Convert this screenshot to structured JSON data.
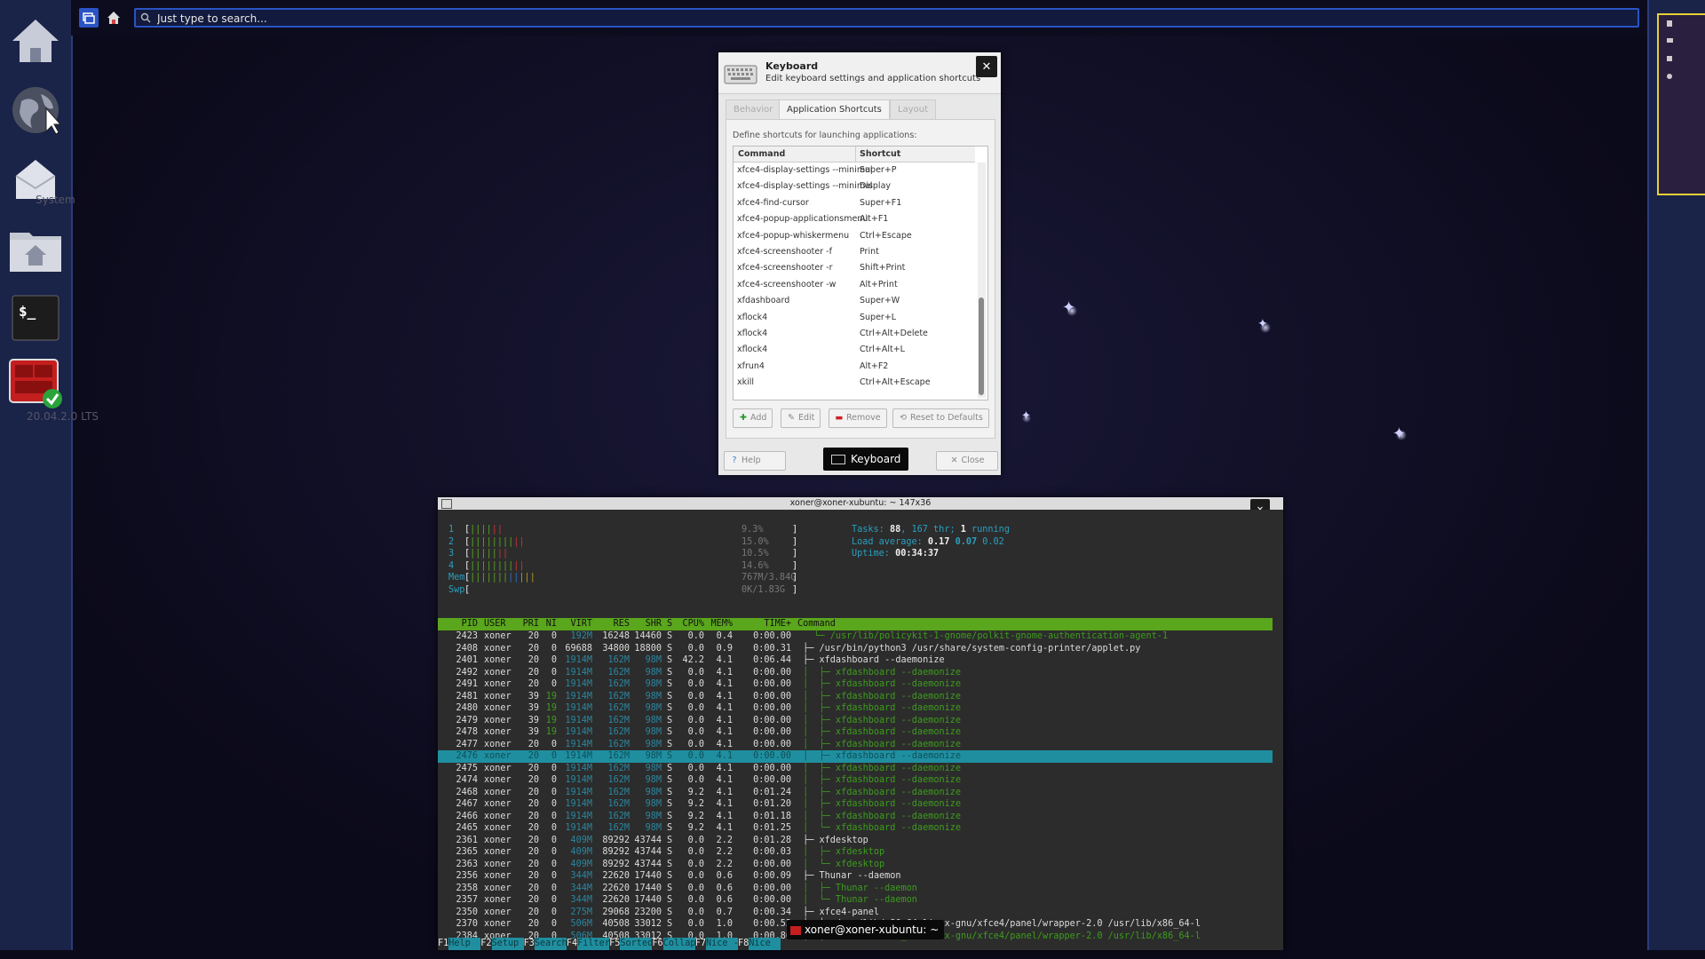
{
  "top_bar": {
    "search_placeholder": "Just type to search..."
  },
  "desktop": {
    "labels": [
      "System",
      "20.04.2.0 LTS"
    ]
  },
  "keyboard_dialog": {
    "title": "Keyboard",
    "subtitle": "Edit keyboard settings and application shortcuts",
    "tabs": [
      "Behavior",
      "Application Shortcuts",
      "Layout"
    ],
    "active_tab": "Application Shortcuts",
    "description": "Define shortcuts for launching applications:",
    "columns": [
      "Command",
      "Shortcut"
    ],
    "rows": [
      [
        "xfce4-display-settings --minimal",
        "Super+P"
      ],
      [
        "xfce4-display-settings --minimal",
        "Display"
      ],
      [
        "xfce4-find-cursor",
        "Super+F1"
      ],
      [
        "xfce4-popup-applicationsmenu",
        "Alt+F1"
      ],
      [
        "xfce4-popup-whiskermenu",
        "Ctrl+Escape"
      ],
      [
        "xfce4-screenshooter -f",
        "Print"
      ],
      [
        "xfce4-screenshooter -r",
        "Shift+Print"
      ],
      [
        "xfce4-screenshooter -w",
        "Alt+Print"
      ],
      [
        "xfdashboard",
        "Super+W"
      ],
      [
        "xflock4",
        "Super+L"
      ],
      [
        "xflock4",
        "Ctrl+Alt+Delete"
      ],
      [
        "xflock4",
        "Ctrl+Alt+L"
      ],
      [
        "xfrun4",
        "Alt+F2"
      ],
      [
        "xkill",
        "Ctrl+Alt+Escape"
      ]
    ],
    "buttons": {
      "add": "Add",
      "edit": "Edit",
      "remove": "Remove",
      "reset": "Reset to Defaults",
      "help": "Help",
      "close": "Close"
    },
    "tooltip": "Keyboard"
  },
  "terminal": {
    "title": "xoner@xoner-xubuntu: ~ 147x36",
    "tooltip": "xoner@xoner-xubuntu: ~",
    "meters": [
      {
        "label": "1",
        "value": "9.3%",
        "level": 0.09
      },
      {
        "label": "2",
        "value": "15.0%",
        "level": 0.15
      },
      {
        "label": "3",
        "value": "10.5%",
        "level": 0.1
      },
      {
        "label": "4",
        "value": "14.6%",
        "level": 0.15
      },
      {
        "label": "Mem",
        "value": "767M/3.84G",
        "level": 0.2
      },
      {
        "label": "Swp",
        "value": "0K/1.83G",
        "level": 0.0
      }
    ],
    "summary": {
      "tasks_label": "Tasks:",
      "tasks": "88",
      "thr_label": "167 thr;",
      "running": "1",
      "running_label": "running",
      "load_label": "Load average:",
      "load1": "0.17",
      "load5": "0.07",
      "load15": "0.02",
      "uptime_label": "Uptime:",
      "uptime": "00:34:37"
    },
    "columns": [
      "PID",
      "USER",
      "PRI",
      "NI",
      "VIRT",
      "RES",
      "SHR",
      "S",
      "CPU%",
      "MEM%",
      "TIME+",
      "Command"
    ],
    "processes": [
      {
        "pid": "2423",
        "user": "xoner",
        "pri": "20",
        "ni": "0",
        "virt": "192M",
        "res": "16248",
        "shr": "14460",
        "s": "S",
        "cpu": "0.0",
        "mem": "0.4",
        "time": "0:00.00",
        "cmd": "   └─ /usr/lib/policykit-1-gnome/polkit-gnome-authentication-agent-1",
        "child": true
      },
      {
        "pid": "2408",
        "user": "xoner",
        "pri": "20",
        "ni": "0",
        "virt": "69688",
        "res": "34800",
        "shr": "18800",
        "s": "S",
        "cpu": "0.0",
        "mem": "0.9",
        "time": "0:00.31",
        "cmd": " ├─ /usr/bin/python3 /usr/share/system-config-printer/applet.py",
        "child": false
      },
      {
        "pid": "2401",
        "user": "xoner",
        "pri": "20",
        "ni": "0",
        "virt": "1914M",
        "res": "162M",
        "shr": "98M",
        "s": "S",
        "cpu": "42.2",
        "mem": "4.1",
        "time": "0:06.44",
        "cmd": " ├─ xfdashboard --daemonize",
        "child": false
      },
      {
        "pid": "2492",
        "user": "xoner",
        "pri": "20",
        "ni": "0",
        "virt": "1914M",
        "res": "162M",
        "shr": "98M",
        "s": "S",
        "cpu": "0.0",
        "mem": "4.1",
        "time": "0:00.00",
        "cmd": " │  ├─ xfdashboard --daemonize",
        "child": true
      },
      {
        "pid": "2491",
        "user": "xoner",
        "pri": "20",
        "ni": "0",
        "virt": "1914M",
        "res": "162M",
        "shr": "98M",
        "s": "S",
        "cpu": "0.0",
        "mem": "4.1",
        "time": "0:00.00",
        "cmd": " │  ├─ xfdashboard --daemonize",
        "child": true
      },
      {
        "pid": "2481",
        "user": "xoner",
        "pri": "39",
        "ni": "19",
        "virt": "1914M",
        "res": "162M",
        "shr": "98M",
        "s": "S",
        "cpu": "0.0",
        "mem": "4.1",
        "time": "0:00.00",
        "cmd": " │  ├─ xfdashboard --daemonize",
        "child": true
      },
      {
        "pid": "2480",
        "user": "xoner",
        "pri": "39",
        "ni": "19",
        "virt": "1914M",
        "res": "162M",
        "shr": "98M",
        "s": "S",
        "cpu": "0.0",
        "mem": "4.1",
        "time": "0:00.00",
        "cmd": " │  ├─ xfdashboard --daemonize",
        "child": true
      },
      {
        "pid": "2479",
        "user": "xoner",
        "pri": "39",
        "ni": "19",
        "virt": "1914M",
        "res": "162M",
        "shr": "98M",
        "s": "S",
        "cpu": "0.0",
        "mem": "4.1",
        "time": "0:00.00",
        "cmd": " │  ├─ xfdashboard --daemonize",
        "child": true
      },
      {
        "pid": "2478",
        "user": "xoner",
        "pri": "39",
        "ni": "19",
        "virt": "1914M",
        "res": "162M",
        "shr": "98M",
        "s": "S",
        "cpu": "0.0",
        "mem": "4.1",
        "time": "0:00.00",
        "cmd": " │  ├─ xfdashboard --daemonize",
        "child": true
      },
      {
        "pid": "2477",
        "user": "xoner",
        "pri": "20",
        "ni": "0",
        "virt": "1914M",
        "res": "162M",
        "shr": "98M",
        "s": "S",
        "cpu": "0.0",
        "mem": "4.1",
        "time": "0:00.00",
        "cmd": " │  ├─ xfdashboard --daemonize",
        "child": true
      },
      {
        "pid": "2476",
        "user": "xoner",
        "pri": "20",
        "ni": "0",
        "virt": "1914M",
        "res": "162M",
        "shr": "98M",
        "s": "S",
        "cpu": "0.0",
        "mem": "4.1",
        "time": "0:00.00",
        "cmd": " │  ├─ xfdashboard --daemonize",
        "child": true,
        "selected": true
      },
      {
        "pid": "2475",
        "user": "xoner",
        "pri": "20",
        "ni": "0",
        "virt": "1914M",
        "res": "162M",
        "shr": "98M",
        "s": "S",
        "cpu": "0.0",
        "mem": "4.1",
        "time": "0:00.00",
        "cmd": " │  ├─ xfdashboard --daemonize",
        "child": true
      },
      {
        "pid": "2474",
        "user": "xoner",
        "pri": "20",
        "ni": "0",
        "virt": "1914M",
        "res": "162M",
        "shr": "98M",
        "s": "S",
        "cpu": "0.0",
        "mem": "4.1",
        "time": "0:00.00",
        "cmd": " │  ├─ xfdashboard --daemonize",
        "child": true
      },
      {
        "pid": "2468",
        "user": "xoner",
        "pri": "20",
        "ni": "0",
        "virt": "1914M",
        "res": "162M",
        "shr": "98M",
        "s": "S",
        "cpu": "9.2",
        "mem": "4.1",
        "time": "0:01.24",
        "cmd": " │  ├─ xfdashboard --daemonize",
        "child": true
      },
      {
        "pid": "2467",
        "user": "xoner",
        "pri": "20",
        "ni": "0",
        "virt": "1914M",
        "res": "162M",
        "shr": "98M",
        "s": "S",
        "cpu": "9.2",
        "mem": "4.1",
        "time": "0:01.20",
        "cmd": " │  ├─ xfdashboard --daemonize",
        "child": true
      },
      {
        "pid": "2466",
        "user": "xoner",
        "pri": "20",
        "ni": "0",
        "virt": "1914M",
        "res": "162M",
        "shr": "98M",
        "s": "S",
        "cpu": "9.2",
        "mem": "4.1",
        "time": "0:01.18",
        "cmd": " │  ├─ xfdashboard --daemonize",
        "child": true
      },
      {
        "pid": "2465",
        "user": "xoner",
        "pri": "20",
        "ni": "0",
        "virt": "1914M",
        "res": "162M",
        "shr": "98M",
        "s": "S",
        "cpu": "9.2",
        "mem": "4.1",
        "time": "0:01.25",
        "cmd": " │  └─ xfdashboard --daemonize",
        "child": true
      },
      {
        "pid": "2361",
        "user": "xoner",
        "pri": "20",
        "ni": "0",
        "virt": "409M",
        "res": "89292",
        "shr": "43744",
        "s": "S",
        "cpu": "0.0",
        "mem": "2.2",
        "time": "0:01.28",
        "cmd": " ├─ xfdesktop",
        "child": false
      },
      {
        "pid": "2365",
        "user": "xoner",
        "pri": "20",
        "ni": "0",
        "virt": "409M",
        "res": "89292",
        "shr": "43744",
        "s": "S",
        "cpu": "0.0",
        "mem": "2.2",
        "time": "0:00.03",
        "cmd": " │  ├─ xfdesktop",
        "child": true
      },
      {
        "pid": "2363",
        "user": "xoner",
        "pri": "20",
        "ni": "0",
        "virt": "409M",
        "res": "89292",
        "shr": "43744",
        "s": "S",
        "cpu": "0.0",
        "mem": "2.2",
        "time": "0:00.00",
        "cmd": " │  └─ xfdesktop",
        "child": true
      },
      {
        "pid": "2356",
        "user": "xoner",
        "pri": "20",
        "ni": "0",
        "virt": "344M",
        "res": "22620",
        "shr": "17440",
        "s": "S",
        "cpu": "0.0",
        "mem": "0.6",
        "time": "0:00.09",
        "cmd": " ├─ Thunar --daemon",
        "child": false
      },
      {
        "pid": "2358",
        "user": "xoner",
        "pri": "20",
        "ni": "0",
        "virt": "344M",
        "res": "22620",
        "shr": "17440",
        "s": "S",
        "cpu": "0.0",
        "mem": "0.6",
        "time": "0:00.00",
        "cmd": " │  ├─ Thunar --daemon",
        "child": true
      },
      {
        "pid": "2357",
        "user": "xoner",
        "pri": "20",
        "ni": "0",
        "virt": "344M",
        "res": "22620",
        "shr": "17440",
        "s": "S",
        "cpu": "0.0",
        "mem": "0.6",
        "time": "0:00.00",
        "cmd": " │  └─ Thunar --daemon",
        "child": true
      },
      {
        "pid": "2350",
        "user": "xoner",
        "pri": "20",
        "ni": "0",
        "virt": "275M",
        "res": "29068",
        "shr": "23200",
        "s": "S",
        "cpu": "0.0",
        "mem": "0.7",
        "time": "0:00.34",
        "cmd": " ├─ xfce4-panel",
        "child": false
      },
      {
        "pid": "2370",
        "user": "xoner",
        "pri": "20",
        "ni": "0",
        "virt": "506M",
        "res": "40508",
        "shr": "33012",
        "s": "S",
        "cpu": "0.0",
        "mem": "1.0",
        "time": "0:00.53",
        "cmd": " │  ├─ /usr/lib/x86_64-linux-gnu/xfce4/panel/wrapper-2.0 /usr/lib/x86_64-l",
        "child": false
      },
      {
        "pid": "2384",
        "user": "xoner",
        "pri": "20",
        "ni": "0",
        "virt": "506M",
        "res": "40508",
        "shr": "33012",
        "s": "S",
        "cpu": "0.0",
        "mem": "1.0",
        "time": "0:00.80",
        "cmd": " │  ├─ /usr/lib/x86_64-linux-gnu/xfce4/panel/wrapper-2.0 /usr/lib/x86_64-l",
        "child": true
      }
    ],
    "fkeys": [
      {
        "key": "F1",
        "label": "Help"
      },
      {
        "key": "F2",
        "label": "Setup"
      },
      {
        "key": "F3",
        "label": "Search"
      },
      {
        "key": "F4",
        "label": "Filter"
      },
      {
        "key": "F5",
        "label": "Sorted"
      },
      {
        "key": "F6",
        "label": "Collap"
      },
      {
        "key": "F7",
        "label": "Nice -"
      },
      {
        "key": "F8",
        "label": "Nice"
      }
    ]
  },
  "icons": {
    "dock": [
      "home-icon",
      "web-browser-icon",
      "mail-icon",
      "file-manager-icon",
      "terminal-icon",
      "software-updater-icon"
    ]
  },
  "colors": {
    "accent": "#2a53c4",
    "panel": "#1a2348",
    "htop_header": "#5aa61c",
    "htop_selected": "#1f8fa0",
    "workspace_border": "#e8d038"
  }
}
